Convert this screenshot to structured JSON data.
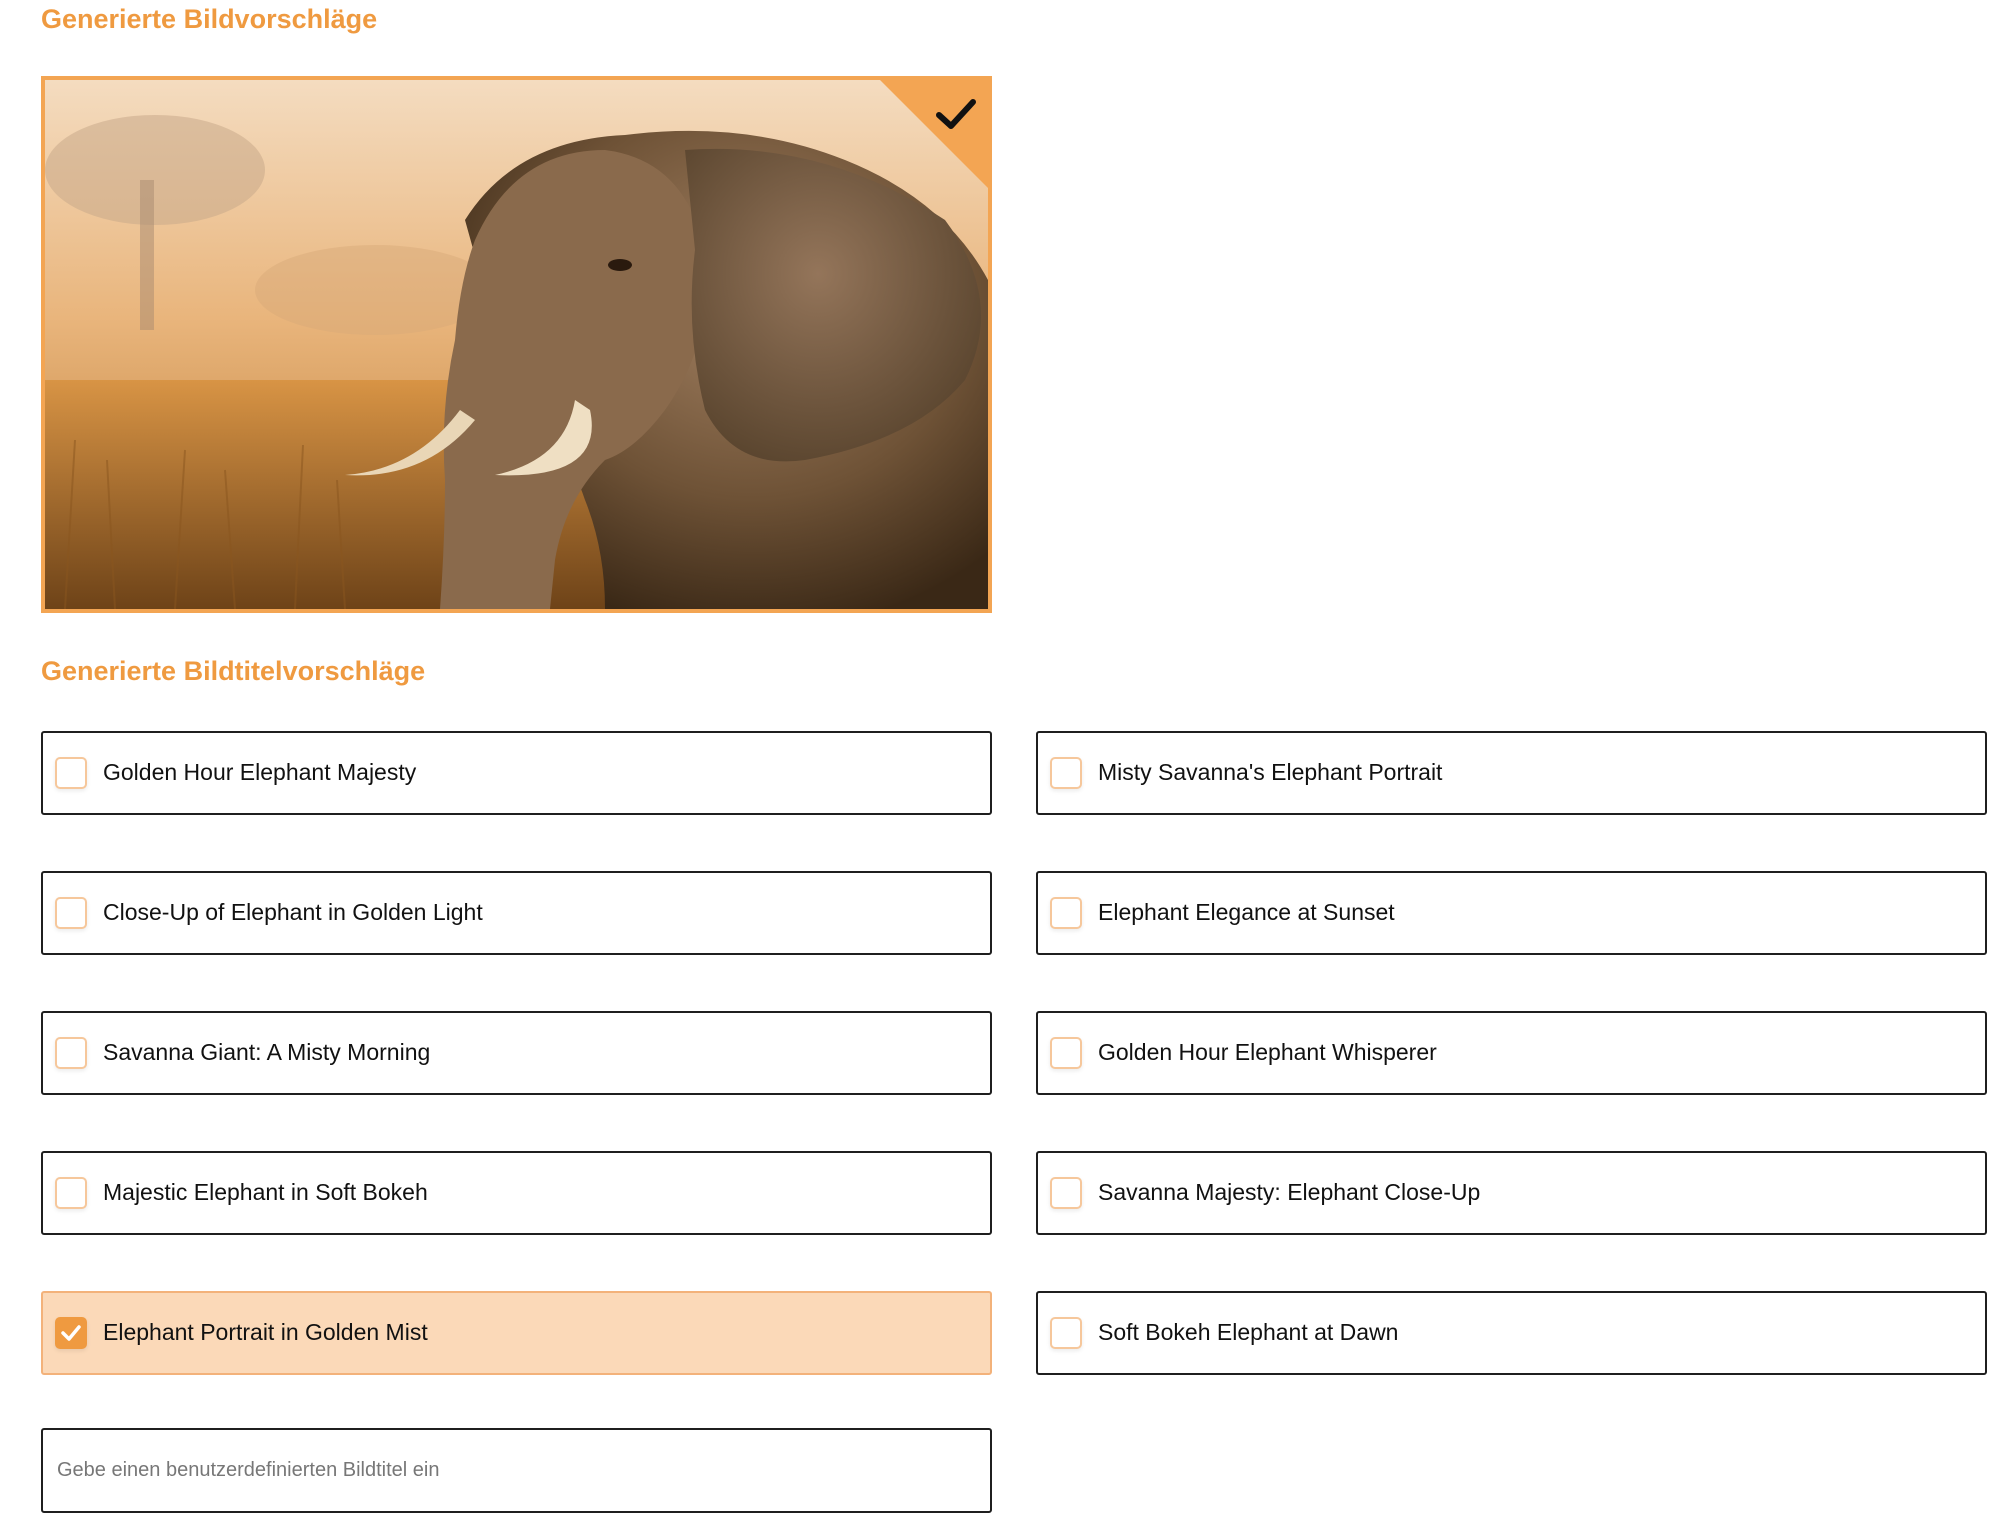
{
  "sections": {
    "image_suggestions_title": "Generierte Bildvorschläge",
    "title_suggestions_title": "Generierte Bildtitelvorschläge"
  },
  "image_card": {
    "selected": true,
    "icon": "check-icon"
  },
  "title_options": [
    {
      "label": "Golden Hour Elephant Majesty",
      "checked": false
    },
    {
      "label": "Misty Savanna's Elephant Portrait",
      "checked": false
    },
    {
      "label": "Close-Up of Elephant in Golden Light",
      "checked": false
    },
    {
      "label": "Elephant Elegance at Sunset",
      "checked": false
    },
    {
      "label": "Savanna Giant: A Misty Morning",
      "checked": false
    },
    {
      "label": "Golden Hour Elephant Whisperer",
      "checked": false
    },
    {
      "label": "Majestic Elephant in Soft Bokeh",
      "checked": false
    },
    {
      "label": "Savanna Majesty: Elephant Close-Up",
      "checked": false
    },
    {
      "label": "Elephant Portrait in Golden Mist",
      "checked": true
    },
    {
      "label": "Soft Bokeh Elephant at Dawn",
      "checked": false
    }
  ],
  "custom_title": {
    "value": "",
    "placeholder": "Gebe einen benutzerdefinierten Bildtitel ein"
  },
  "colors": {
    "accent": "#ef9a40",
    "selected_bg": "#fbd9b8",
    "border": "#1f1f1f"
  }
}
